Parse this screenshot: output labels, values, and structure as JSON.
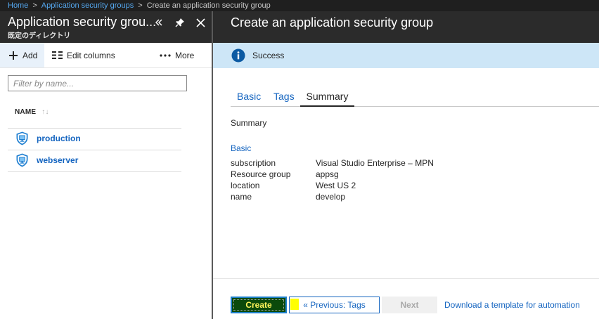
{
  "breadcrumb": {
    "items": [
      "Home",
      "Application security groups",
      "Create an application security group"
    ],
    "separator": ">"
  },
  "left_blade": {
    "title": "Application security grou...",
    "subtitle": "既定のディレクトリ",
    "toolbar": {
      "add_label": "Add",
      "edit_columns_label": "Edit columns",
      "more_label": "More"
    },
    "filter_placeholder": "Filter by name...",
    "column_header": "NAME",
    "items": [
      {
        "label": "production",
        "icon": "application-security-group-icon"
      },
      {
        "label": "webserver",
        "icon": "application-security-group-icon"
      }
    ]
  },
  "right_blade": {
    "title": "Create an application security group",
    "banner": {
      "icon": "info-icon",
      "message": "Success"
    },
    "tabs": [
      {
        "label": "Basic",
        "active": false
      },
      {
        "label": "Tags",
        "active": false
      },
      {
        "label": "Summary",
        "active": true
      }
    ],
    "summary_heading": "Summary",
    "section_heading": "Basic",
    "fields": [
      {
        "key": "subscription",
        "value": "Visual Studio Enterprise – MPN"
      },
      {
        "key": "Resource group",
        "value": "appsg"
      },
      {
        "key": "location",
        "value": "West US 2"
      },
      {
        "key": "name",
        "value": "develop"
      }
    ],
    "footer": {
      "create_label": "Create",
      "previous_label": "« Previous: Tags",
      "next_label": "Next",
      "download_label": "Download a template for automation"
    }
  },
  "colors": {
    "header_bg": "#2b2b2b",
    "link": "#1565c0",
    "banner_bg": "#cde6f7",
    "create_bg": "#0b4a0b",
    "create_text": "#fff45a"
  }
}
